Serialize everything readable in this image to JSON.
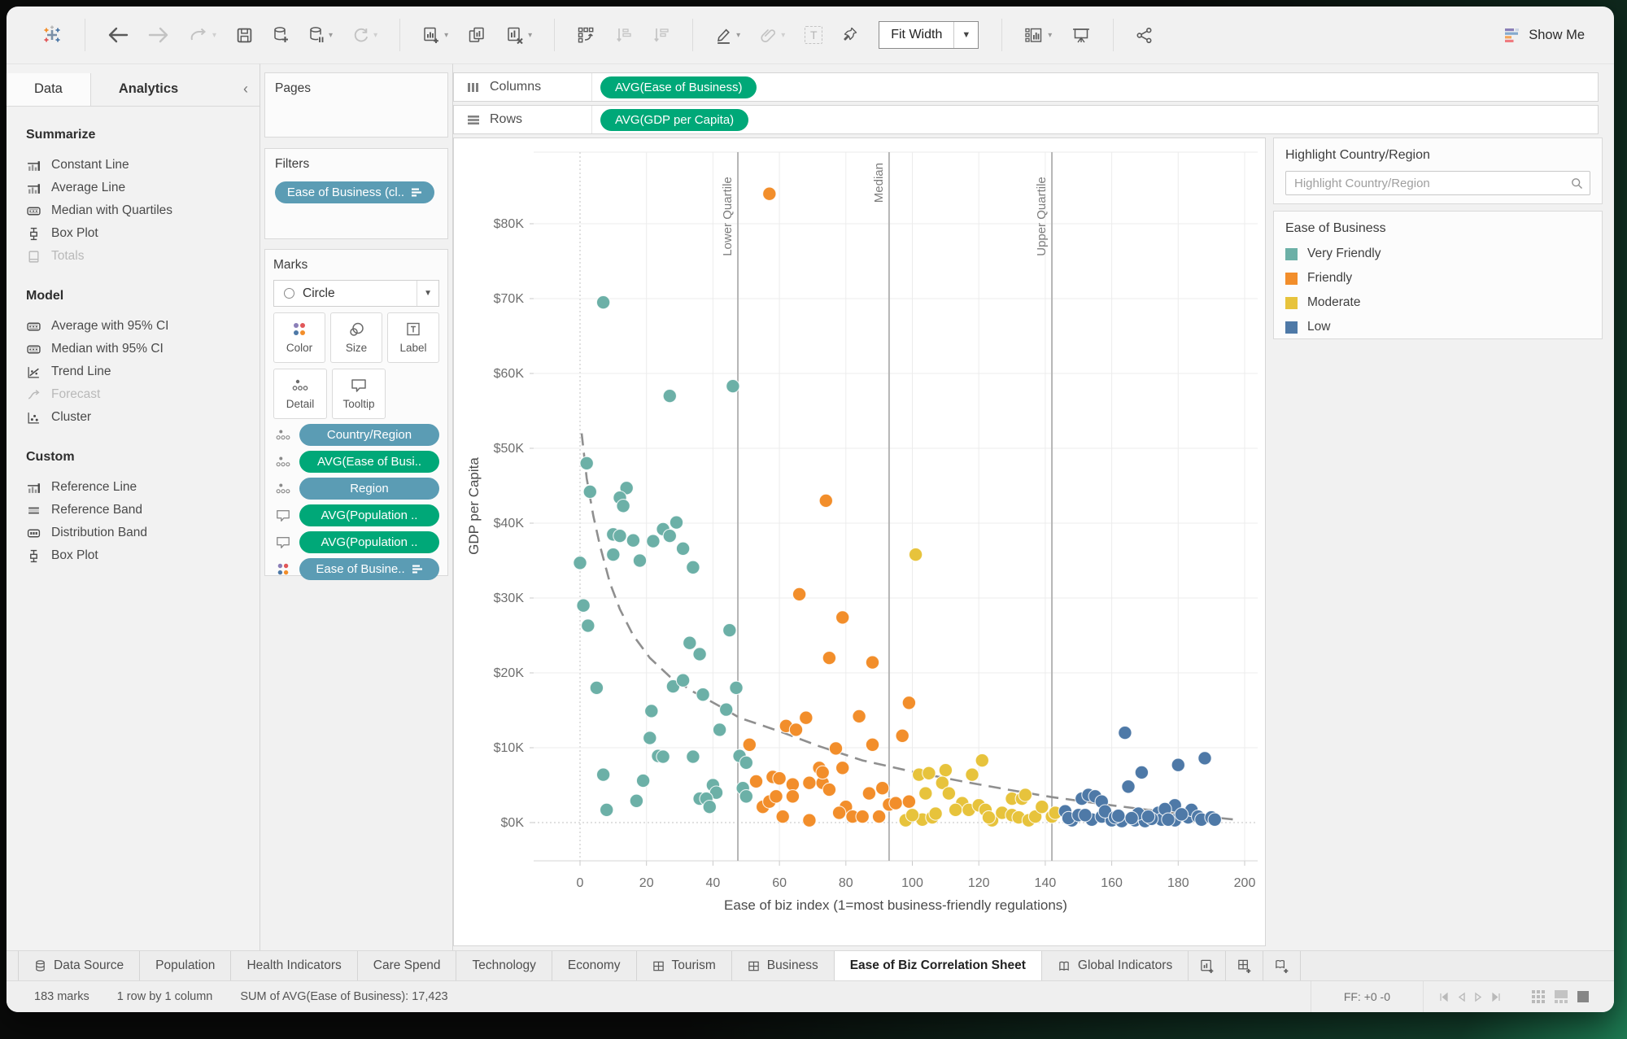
{
  "toolbar": {
    "fit_width": "Fit Width",
    "show_me": "Show Me"
  },
  "sidebar": {
    "tabs": [
      {
        "label": "Data"
      },
      {
        "label": "Analytics"
      }
    ],
    "sections": [
      {
        "title": "Summarize",
        "items": [
          {
            "label": "Constant Line",
            "disabled": false
          },
          {
            "label": "Average Line",
            "disabled": false
          },
          {
            "label": "Median with Quartiles",
            "disabled": false
          },
          {
            "label": "Box Plot",
            "disabled": false
          },
          {
            "label": "Totals",
            "disabled": true
          }
        ]
      },
      {
        "title": "Model",
        "items": [
          {
            "label": "Average with 95% CI",
            "disabled": false
          },
          {
            "label": "Median with 95% CI",
            "disabled": false
          },
          {
            "label": "Trend Line",
            "disabled": false
          },
          {
            "label": "Forecast",
            "disabled": true
          },
          {
            "label": "Cluster",
            "disabled": false
          }
        ]
      },
      {
        "title": "Custom",
        "items": [
          {
            "label": "Reference Line",
            "disabled": false
          },
          {
            "label": "Reference Band",
            "disabled": false
          },
          {
            "label": "Distribution Band",
            "disabled": false
          },
          {
            "label": "Box Plot",
            "disabled": false
          }
        ]
      }
    ]
  },
  "cards": {
    "pages": {
      "title": "Pages"
    },
    "filters": {
      "title": "Filters",
      "pill": "Ease of Business (cl.."
    },
    "marks": {
      "title": "Marks",
      "mark_type": "Circle",
      "buttons": [
        "Color",
        "Size",
        "Label",
        "Detail",
        "Tooltip"
      ],
      "pills": [
        {
          "label": "Country/Region",
          "color": "blue",
          "icon": "detail"
        },
        {
          "label": "AVG(Ease of Busi..",
          "color": "green",
          "icon": "detail"
        },
        {
          "label": "Region",
          "color": "blue",
          "icon": "detail"
        },
        {
          "label": "AVG(Population ..",
          "color": "green",
          "icon": "tooltip"
        },
        {
          "label": "AVG(Population ..",
          "color": "green",
          "icon": "tooltip"
        },
        {
          "label": "Ease of Busine..",
          "color": "blue",
          "icon": "color"
        }
      ]
    }
  },
  "shelves": {
    "columns": {
      "label": "Columns",
      "pill": "AVG(Ease of Business)"
    },
    "rows": {
      "label": "Rows",
      "pill": "AVG(GDP per Capita)"
    }
  },
  "right_panel": {
    "highlight_title": "Highlight Country/Region",
    "search_placeholder": "Highlight Country/Region",
    "legend_title": "Ease of Business",
    "legend": [
      {
        "label": "Very Friendly",
        "color": "#6CB0A7"
      },
      {
        "label": "Friendly",
        "color": "#F28E2B"
      },
      {
        "label": "Moderate",
        "color": "#E7C33C"
      },
      {
        "label": "Low",
        "color": "#4E79A7"
      }
    ]
  },
  "chart_data": {
    "type": "scatter",
    "xlabel": "Ease of biz index (1=most business-friendly regulations)",
    "ylabel": "GDP per Capita",
    "x_ticks": [
      0,
      20,
      40,
      60,
      80,
      100,
      120,
      140,
      160,
      180,
      200
    ],
    "y_ticks_k": [
      0,
      10,
      20,
      30,
      40,
      50,
      60,
      70,
      80
    ],
    "xlim": [
      -14,
      204
    ],
    "ylim_k": [
      -6,
      89
    ],
    "grid": true,
    "reference_lines": [
      {
        "x": 47.5,
        "label": "Lower Quartile"
      },
      {
        "x": 93,
        "label": "Median"
      },
      {
        "x": 142,
        "label": "Upper Quartile"
      }
    ],
    "trend_dashed": [
      [
        0.5,
        52
      ],
      [
        2,
        46
      ],
      [
        4,
        41
      ],
      [
        6,
        37
      ],
      [
        9,
        32
      ],
      [
        12,
        28.5
      ],
      [
        16,
        25
      ],
      [
        21,
        22
      ],
      [
        27,
        19.5
      ],
      [
        34,
        17.5
      ],
      [
        43,
        15.3
      ],
      [
        48,
        14
      ],
      [
        60,
        12.2
      ],
      [
        72,
        10.2
      ],
      [
        85,
        8.3
      ],
      [
        100,
        6.8
      ],
      [
        115,
        5.5
      ],
      [
        130,
        4.3
      ],
      [
        142,
        3.4
      ],
      [
        160,
        2.3
      ],
      [
        180,
        1.2
      ],
      [
        197,
        0.4
      ]
    ],
    "series": [
      {
        "name": "Very Friendly",
        "color": "#6CB0A7",
        "points": [
          [
            7,
            69.5
          ],
          [
            27,
            57
          ],
          [
            46,
            58.3
          ],
          [
            2,
            48
          ],
          [
            3,
            44.2
          ],
          [
            14,
            44.7
          ],
          [
            12,
            43.4
          ],
          [
            13,
            42.3
          ],
          [
            10,
            38.5
          ],
          [
            12,
            38.3
          ],
          [
            16,
            37.7
          ],
          [
            29,
            40.1
          ],
          [
            25,
            39.2
          ],
          [
            27,
            38.3
          ],
          [
            22,
            37.6
          ],
          [
            31,
            36.6
          ],
          [
            10,
            35.8
          ],
          [
            18,
            35
          ],
          [
            0,
            34.7
          ],
          [
            34,
            34.1
          ],
          [
            1,
            29
          ],
          [
            2.4,
            26.3
          ],
          [
            45,
            25.7
          ],
          [
            33,
            24
          ],
          [
            36,
            22.5
          ],
          [
            5,
            18
          ],
          [
            28,
            18.2
          ],
          [
            31,
            19
          ],
          [
            37,
            17.1
          ],
          [
            47,
            18
          ],
          [
            44,
            15.1
          ],
          [
            21.5,
            14.9
          ],
          [
            42,
            12.4
          ],
          [
            21,
            11.3
          ],
          [
            23.5,
            8.9
          ],
          [
            25,
            8.8
          ],
          [
            34,
            8.8
          ],
          [
            48,
            8.9
          ],
          [
            50,
            8
          ],
          [
            7,
            6.4
          ],
          [
            19,
            5.6
          ],
          [
            40,
            5
          ],
          [
            41,
            4
          ],
          [
            36,
            3.2
          ],
          [
            38,
            3.2
          ],
          [
            17,
            2.9
          ],
          [
            39,
            2.1
          ],
          [
            8,
            1.7
          ],
          [
            49,
            4.6
          ],
          [
            50,
            3.5
          ]
        ]
      },
      {
        "name": "Friendly",
        "color": "#F28E2B",
        "points": [
          [
            57,
            84
          ],
          [
            74,
            43
          ],
          [
            66,
            30.5
          ],
          [
            79,
            27.4
          ],
          [
            75,
            22
          ],
          [
            88,
            21.4
          ],
          [
            99,
            16
          ],
          [
            84,
            14.2
          ],
          [
            97,
            11.6
          ],
          [
            62,
            12.9
          ],
          [
            65,
            12.4
          ],
          [
            68,
            14
          ],
          [
            88,
            10.4
          ],
          [
            51,
            10.4
          ],
          [
            77,
            9.9
          ],
          [
            53,
            5.5
          ],
          [
            58,
            6.1
          ],
          [
            60,
            5.9
          ],
          [
            64,
            5.1
          ],
          [
            69,
            5.3
          ],
          [
            73,
            5.3
          ],
          [
            75,
            4.4
          ],
          [
            79,
            7.3
          ],
          [
            72,
            7.3
          ],
          [
            55,
            2.1
          ],
          [
            57,
            2.8
          ],
          [
            61,
            0.8
          ],
          [
            69,
            0.3
          ],
          [
            80,
            2.1
          ],
          [
            78,
            1.3
          ],
          [
            82,
            0.8
          ],
          [
            64,
            3.5
          ],
          [
            59,
            3.5
          ],
          [
            73,
            6.7
          ],
          [
            87,
            3.9
          ],
          [
            91,
            4.6
          ],
          [
            93,
            2.4
          ],
          [
            95,
            2.6
          ],
          [
            99,
            2.8
          ],
          [
            90,
            0.8
          ],
          [
            85,
            0.8
          ]
        ]
      },
      {
        "name": "Moderate",
        "color": "#E7C33C",
        "points": [
          [
            101,
            35.8
          ],
          [
            121,
            8.3
          ],
          [
            102,
            6.4
          ],
          [
            105,
            6.6
          ],
          [
            110,
            7
          ],
          [
            109,
            5.3
          ],
          [
            118,
            6.4
          ],
          [
            104,
            3.9
          ],
          [
            111,
            3.9
          ],
          [
            115,
            2.6
          ],
          [
            113,
            1.7
          ],
          [
            117,
            1.7
          ],
          [
            120,
            2.3
          ],
          [
            103,
            0.4
          ],
          [
            106,
            0.7
          ],
          [
            107,
            1.2
          ],
          [
            122,
            1.7
          ],
          [
            124,
            0.3
          ],
          [
            123,
            0.7
          ],
          [
            127,
            1.3
          ],
          [
            130,
            3.2
          ],
          [
            130,
            1
          ],
          [
            133,
            3.2
          ],
          [
            132,
            0.7
          ],
          [
            135,
            0.3
          ],
          [
            137,
            0.8
          ],
          [
            139,
            2.1
          ],
          [
            142,
            0.8
          ],
          [
            143,
            1.3
          ],
          [
            134,
            3.7
          ],
          [
            98,
            0.3
          ],
          [
            100,
            1
          ]
        ]
      },
      {
        "name": "Low",
        "color": "#4E79A7",
        "points": [
          [
            164,
            12
          ],
          [
            188,
            8.6
          ],
          [
            180,
            7.7
          ],
          [
            169,
            6.7
          ],
          [
            165,
            4.8
          ],
          [
            151,
            3.2
          ],
          [
            153,
            3.7
          ],
          [
            155,
            3.5
          ],
          [
            146,
            1.5
          ],
          [
            148,
            0.3
          ],
          [
            154,
            0.4
          ],
          [
            157,
            0.8
          ],
          [
            160,
            0.3
          ],
          [
            163,
            0.2
          ],
          [
            167,
            0.3
          ],
          [
            170,
            0.2
          ],
          [
            174,
            1.3
          ],
          [
            175,
            0.4
          ],
          [
            179,
            2.3
          ],
          [
            179,
            0.3
          ],
          [
            183,
            0.7
          ],
          [
            184,
            1.7
          ],
          [
            186,
            0.8
          ],
          [
            187,
            0.4
          ],
          [
            190,
            0.7
          ],
          [
            157,
            2.8
          ],
          [
            147,
            0.6
          ],
          [
            150,
            1
          ],
          [
            152,
            1
          ],
          [
            158,
            1.5
          ],
          [
            161,
            0.7
          ],
          [
            168,
            1.2
          ],
          [
            172,
            0.5
          ],
          [
            176,
            1.8
          ],
          [
            181,
            1.1
          ],
          [
            191,
            0.4
          ],
          [
            162,
            0.9
          ],
          [
            166,
            0.6
          ],
          [
            171,
            0.8
          ],
          [
            177,
            0.4
          ]
        ]
      }
    ]
  },
  "tabs_bar": {
    "tabs": [
      {
        "label": "Data Source",
        "icon": "database",
        "active": false
      },
      {
        "label": "Population",
        "icon": "",
        "active": false
      },
      {
        "label": "Health Indicators",
        "icon": "",
        "active": false
      },
      {
        "label": "Care Spend",
        "icon": "",
        "active": false
      },
      {
        "label": "Technology",
        "icon": "",
        "active": false
      },
      {
        "label": "Economy",
        "icon": "",
        "active": false
      },
      {
        "label": "Tourism",
        "icon": "dashboard",
        "active": false
      },
      {
        "label": "Business",
        "icon": "dashboard",
        "active": false
      },
      {
        "label": "Ease of Biz Correlation Sheet",
        "icon": "",
        "active": true
      },
      {
        "label": "Global Indicators",
        "icon": "story",
        "active": false
      }
    ]
  },
  "status_bar": {
    "marks": "183 marks",
    "size": "1 row by 1 column",
    "aggregate": "SUM of AVG(Ease of Business): 17,423",
    "ff": "FF: +0 -0"
  }
}
